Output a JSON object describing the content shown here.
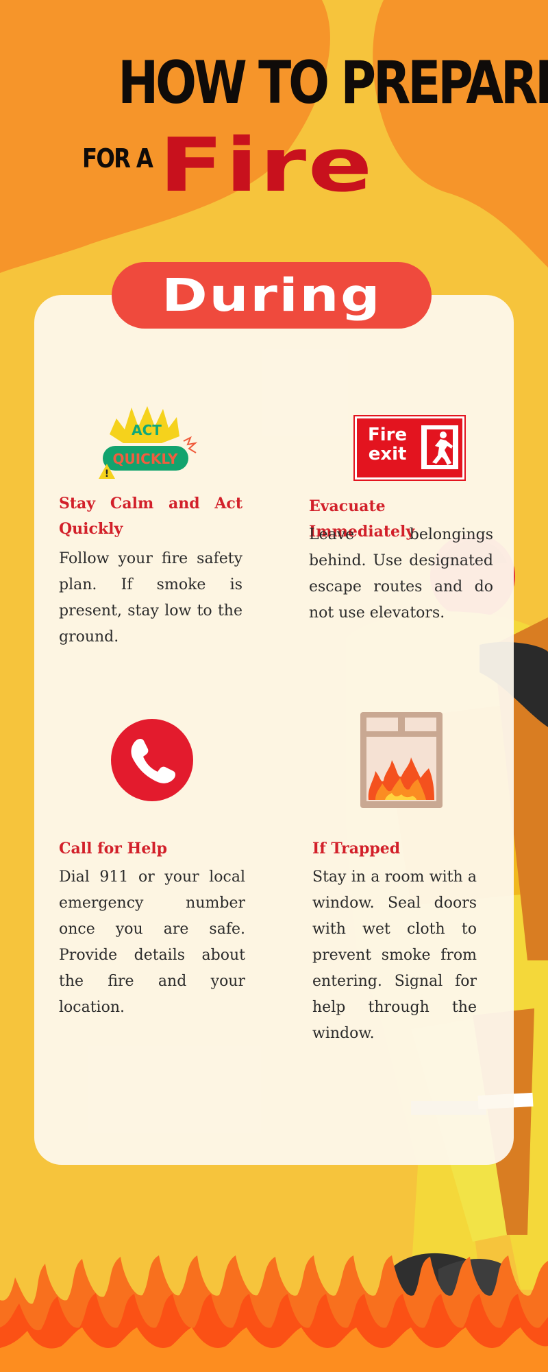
{
  "header": {
    "title_line1": "HOW TO PREPARE",
    "title_prefix": "FOR A",
    "title_highlight": "Fire"
  },
  "section": {
    "badge": "During"
  },
  "colors": {
    "background": "#f6c43c",
    "orange": "#f6952a",
    "accent_red": "#d2202a",
    "badge_red": "#ef4a3d",
    "card": "#fdf8ed"
  },
  "tips": [
    {
      "icon": "act-quickly-icon",
      "icon_text_1": "ACT",
      "icon_text_2": "QUICKLY",
      "heading": "Stay Calm and Act Quickly",
      "body": "Follow your fire safety plan. If smoke is present, stay low to the ground."
    },
    {
      "icon": "fire-exit-sign-icon",
      "icon_text_1": "Fire",
      "icon_text_2": "exit",
      "heading": "Evacuate Immediately",
      "body": "Leave belongings behind. Use designated escape routes and do not use elevators."
    },
    {
      "icon": "phone-icon",
      "heading": "Call for Help",
      "body": "Dial 911 or your local emergency number once you are safe. Provide details about the fire and your location."
    },
    {
      "icon": "burning-window-icon",
      "heading": "If Trapped",
      "body": "Stay in a room with a window. Seal doors with wet cloth to prevent smoke from entering. Signal for help through the window."
    }
  ]
}
